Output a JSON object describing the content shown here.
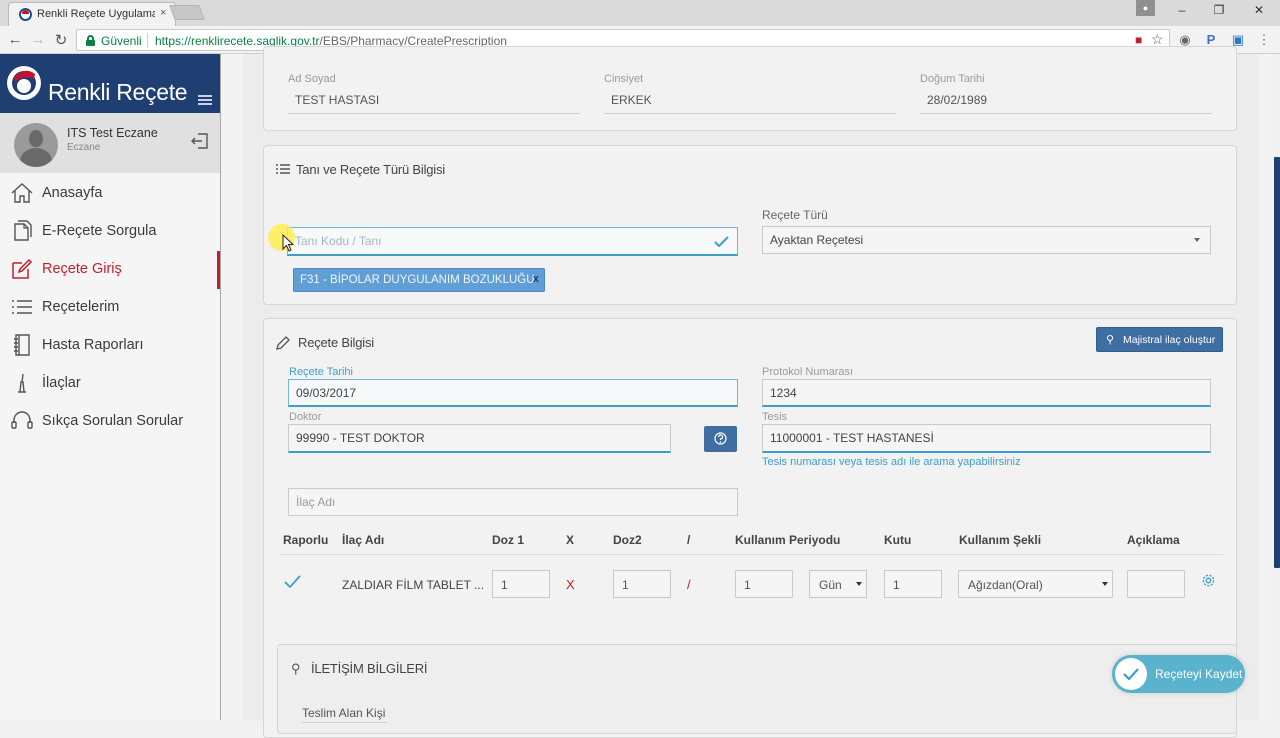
{
  "browser": {
    "tab_title": "Renkli Reçete Uygulaması",
    "tab_close": "×",
    "secure_label": "Güvenli",
    "url_host": "https://renklirecete.saglik.gov.tr",
    "url_path": "/EBS/Pharmacy/CreatePrescription",
    "ext_p": "P"
  },
  "sidebar": {
    "brand_name": "Renkli Reçete",
    "user_name": "ITS Test Eczane",
    "user_role": "Eczane",
    "items": [
      {
        "label": "Anasayfa",
        "icon": "home-icon"
      },
      {
        "label": "E-Reçete Sorgula",
        "icon": "documents-icon"
      },
      {
        "label": "Reçete Giriş",
        "icon": "edit-icon",
        "active": true
      },
      {
        "label": "Reçetelerim",
        "icon": "list-icon"
      },
      {
        "label": "Hasta Raporları",
        "icon": "notebook-icon"
      },
      {
        "label": "İlaçlar",
        "icon": "pestle-icon"
      },
      {
        "label": "Sıkça Sorulan Sorular",
        "icon": "headset-icon"
      }
    ]
  },
  "patient": {
    "name_label": "Ad Soyad",
    "name_value": "TEST HASTASI",
    "gender_label": "Cinsiyet",
    "gender_value": "ERKEK",
    "dob_label": "Doğum Tarihi",
    "dob_value": "28/02/1989"
  },
  "diagnosis": {
    "title": "Tanı ve Reçete Türü Bilgisi",
    "code_placeholder": "Tanı Kodu / Tanı",
    "type_label": "Reçete Türü",
    "type_value": "Ayaktan Reçetesi",
    "tag": "F31 - BİPOLAR DUYGULANIM BOZUKLUĞU",
    "tag_remove": "x"
  },
  "prescription": {
    "title": "Reçete Bilgisi",
    "majistral_button": "Majistral ilaç oluştur",
    "date_label": "Reçete Tarihi",
    "date_value": "09/03/2017",
    "protocol_label": "Protokol Numarası",
    "protocol_value": "1234",
    "doctor_label": "Doktor",
    "doctor_value": "99990 - TEST DOKTOR",
    "facility_label": "Tesis",
    "facility_value": "11000001 - TEST HASTANESİ",
    "facility_hint": "Tesis numarası veya tesis adı ile arama yapabilirsiniz",
    "drug_placeholder": "İlaç Adı"
  },
  "drug_table": {
    "headers": {
      "reported": "Raporlu",
      "drug_name": "İlaç Adı",
      "dose1": "Doz 1",
      "x": "X",
      "dose2": "Doz2",
      "slash": "/",
      "period": "Kullanım Periyodu",
      "box": "Kutu",
      "usage": "Kullanım Şekli",
      "note": "Açıklama"
    },
    "rows": [
      {
        "drug_name": "ZALDIAR FİLM TABLET ...",
        "dose1": "1",
        "x": "X",
        "dose2": "1",
        "slash": "/",
        "period": "1",
        "period_unit": "Gün",
        "box": "1",
        "usage": "Ağızdan(Oral)",
        "note": ""
      }
    ]
  },
  "contact": {
    "title": "İLETİŞİM BİLGİLERİ",
    "receiver_label": "Teslim Alan Kişi"
  },
  "actions": {
    "save": "Reçeteyi Kaydet"
  },
  "colors": {
    "brand": "#1f3f73",
    "active": "#c21f2e",
    "accent": "#3f9ec7",
    "tag": "#5f9fd5"
  }
}
